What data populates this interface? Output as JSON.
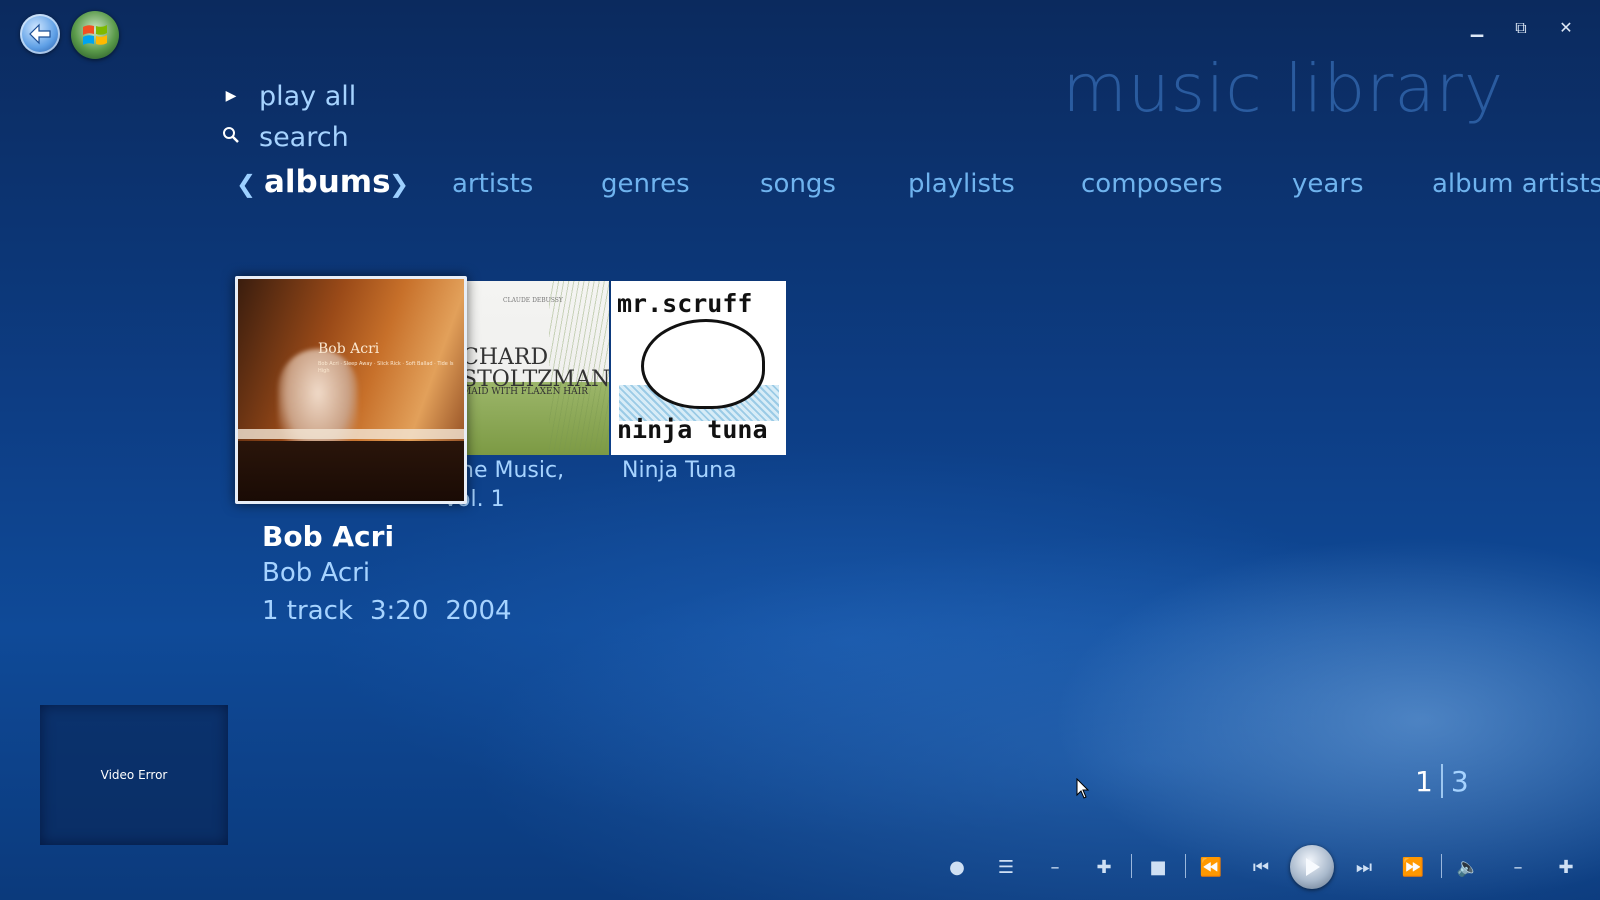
{
  "window": {
    "title": "music library",
    "controls": [
      "minimize-icon",
      "restore-icon",
      "close-icon"
    ]
  },
  "top_left": {
    "back_icon": "back-arrow-icon",
    "start_icon": "windows-orb-icon"
  },
  "actions": [
    {
      "icon": "play-icon",
      "label": "play all"
    },
    {
      "icon": "search-icon",
      "label": "search"
    }
  ],
  "nav": {
    "active": "albums",
    "items": [
      "artists",
      "genres",
      "songs",
      "playlists",
      "composers",
      "years",
      "album artists"
    ]
  },
  "albums": [
    {
      "cover_text": [
        "Bob Acri",
        "Bob Acri · Sleep Away · Slick Rick · Soft Ballad · Tide Is High"
      ],
      "selected": true
    },
    {
      "cover_text": [
        "CHARD",
        "STOLTZMAN",
        "MAID WITH FLAXEN HAIR",
        "CLAUDE DEBUSSY"
      ],
      "caption": [
        "he Music,",
        "vol. 1"
      ]
    },
    {
      "cover_text": [
        "mr.scruff",
        "ninja tuna"
      ],
      "caption": [
        "Ninja Tuna"
      ]
    }
  ],
  "selected_album": {
    "title": "Bob Acri",
    "artist": "Bob Acri",
    "tracks": "1 track",
    "duration": "3:20",
    "year": "2004"
  },
  "video_error": "Video Error",
  "pager": {
    "current": "1",
    "total": "3"
  },
  "transport": {
    "icons": [
      "record-icon",
      "list-icon",
      "minus-icon",
      "plus-icon",
      "stop-icon",
      "rewind-icon",
      "previous-icon",
      "play-icon",
      "next-icon",
      "fast-forward-icon",
      "volume-icon",
      "volume-down-icon",
      "volume-up-icon"
    ]
  }
}
